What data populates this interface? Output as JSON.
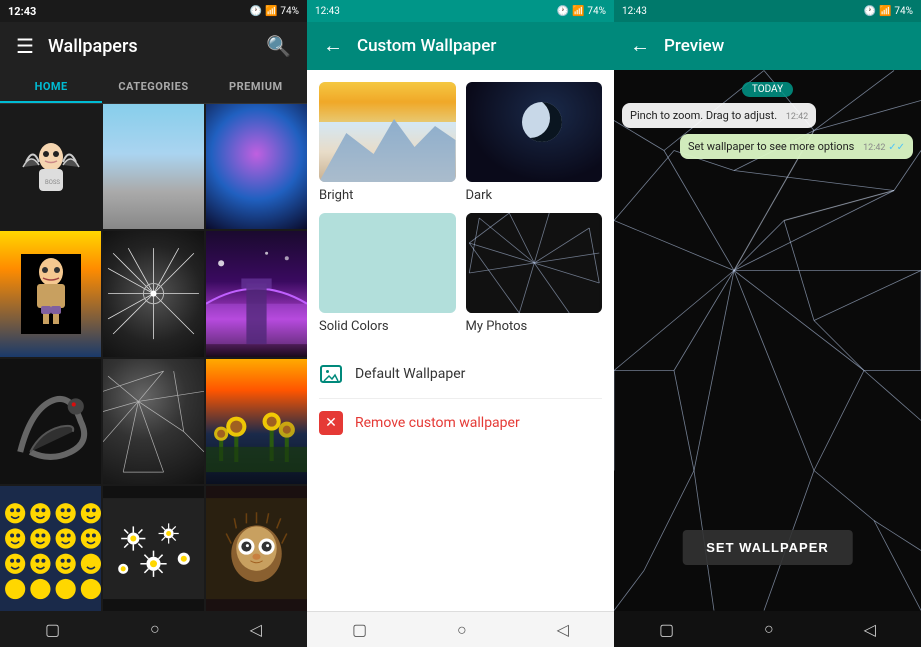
{
  "panel1": {
    "time": "12:43",
    "battery": "74%",
    "title": "Wallpapers",
    "tabs": [
      "HOME",
      "CATEGORIES",
      "PREMIUM"
    ],
    "active_tab": 0,
    "nav": {
      "square": "▢",
      "circle": "○",
      "triangle": "◁"
    }
  },
  "panel2": {
    "time": "12:43",
    "battery": "74%",
    "back_icon": "←",
    "title": "Custom Wallpaper",
    "options": [
      {
        "id": "bright",
        "label": "Bright"
      },
      {
        "id": "dark",
        "label": "Dark"
      },
      {
        "id": "solid",
        "label": "Solid Colors"
      },
      {
        "id": "photos",
        "label": "My Photos"
      }
    ],
    "default_wallpaper": "Default Wallpaper",
    "remove_wallpaper": "Remove custom wallpaper",
    "nav": {
      "square": "▢",
      "circle": "○",
      "triangle": "◁"
    }
  },
  "panel3": {
    "time": "12:43",
    "battery": "74%",
    "back_icon": "←",
    "title": "Preview",
    "chat": {
      "date": "TODAY",
      "bubble1": "Pinch to zoom. Drag to adjust.",
      "time1": "12:42",
      "bubble2": "Set wallpaper to see more options",
      "time2": "12:42",
      "tick": "✓✓"
    },
    "set_button": "SET WALLPAPER",
    "nav": {
      "square": "▢",
      "circle": "○",
      "triangle": "◁"
    }
  }
}
